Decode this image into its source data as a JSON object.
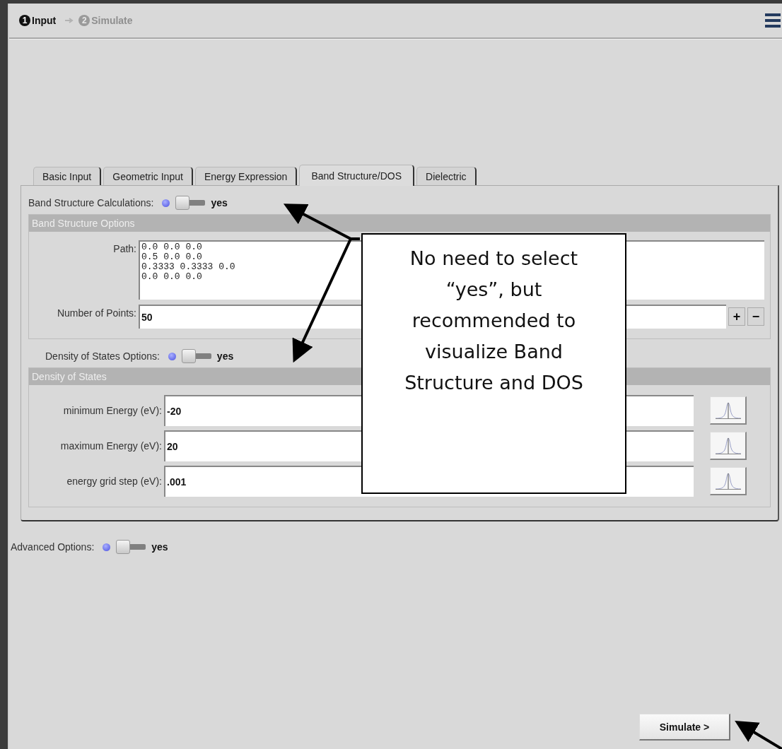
{
  "steps": [
    {
      "number": "1",
      "label": "Input",
      "selected": true
    },
    {
      "number": "2",
      "label": "Simulate",
      "selected": false
    }
  ],
  "tabs": [
    {
      "label": "Basic Input",
      "selected": false
    },
    {
      "label": "Geometric Input",
      "selected": false
    },
    {
      "label": "Energy Expression",
      "selected": false
    },
    {
      "label": "Band Structure/DOS",
      "selected": true
    },
    {
      "label": "Dielectric",
      "selected": false
    }
  ],
  "band_structure_calculations": {
    "label": "Band Structure Calculations:",
    "on": true,
    "value": "yes"
  },
  "band_structure_options": {
    "title": "Band Structure Options",
    "path_label": "Path:",
    "path": "0.0 0.0 0.0\n0.5 0.0 0.0\n0.3333 0.3333 0.0\n0.0 0.0 0.0",
    "points_label": "Number of Points:",
    "points": "50",
    "add": "+",
    "remove": "−"
  },
  "density_of_states_options": {
    "label": "Density of States Options:",
    "on": true,
    "value": "yes"
  },
  "density_of_states": {
    "title": "Density of States",
    "fields": [
      {
        "label": "minimum Energy (eV):",
        "value": "-20"
      },
      {
        "label": "maximum Energy (eV):",
        "value": "20"
      },
      {
        "label": "energy grid step (eV):",
        "value": ".001"
      }
    ]
  },
  "advanced_options": {
    "label": "Advanced Options:",
    "on": true,
    "value": "yes"
  },
  "simulate_button": "Simulate >",
  "callout": "No need to select “yes”, but recommended to visualize Band Structure and DOS"
}
